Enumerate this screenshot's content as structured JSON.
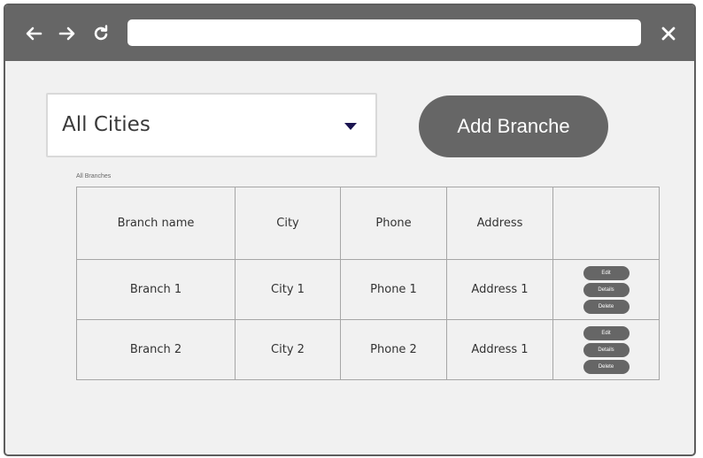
{
  "browser": {
    "back_icon": "back-arrow-icon",
    "forward_icon": "forward-arrow-icon",
    "reload_icon": "reload-icon",
    "close_icon": "close-icon",
    "url_value": ""
  },
  "filter": {
    "city_selected": "All Cities",
    "dropdown_icon": "caret-down-icon"
  },
  "add_button_label": "Add Branche",
  "table": {
    "caption": "All Branches",
    "headers": [
      "Branch name",
      "City",
      "Phone",
      "Address",
      ""
    ],
    "rows": [
      {
        "name": "Branch 1",
        "city": "City 1",
        "phone": "Phone 1",
        "address": "Address 1"
      },
      {
        "name": "Branch 2",
        "city": "City 2",
        "phone": "Phone 2",
        "address": "Address 1"
      }
    ],
    "actions": {
      "edit": "Edit",
      "details": "Details",
      "delete": "Delete"
    }
  },
  "colors": {
    "chrome": "#666666",
    "page_bg": "#f1f1f1",
    "button": "#666666",
    "caret": "#1a1450"
  }
}
